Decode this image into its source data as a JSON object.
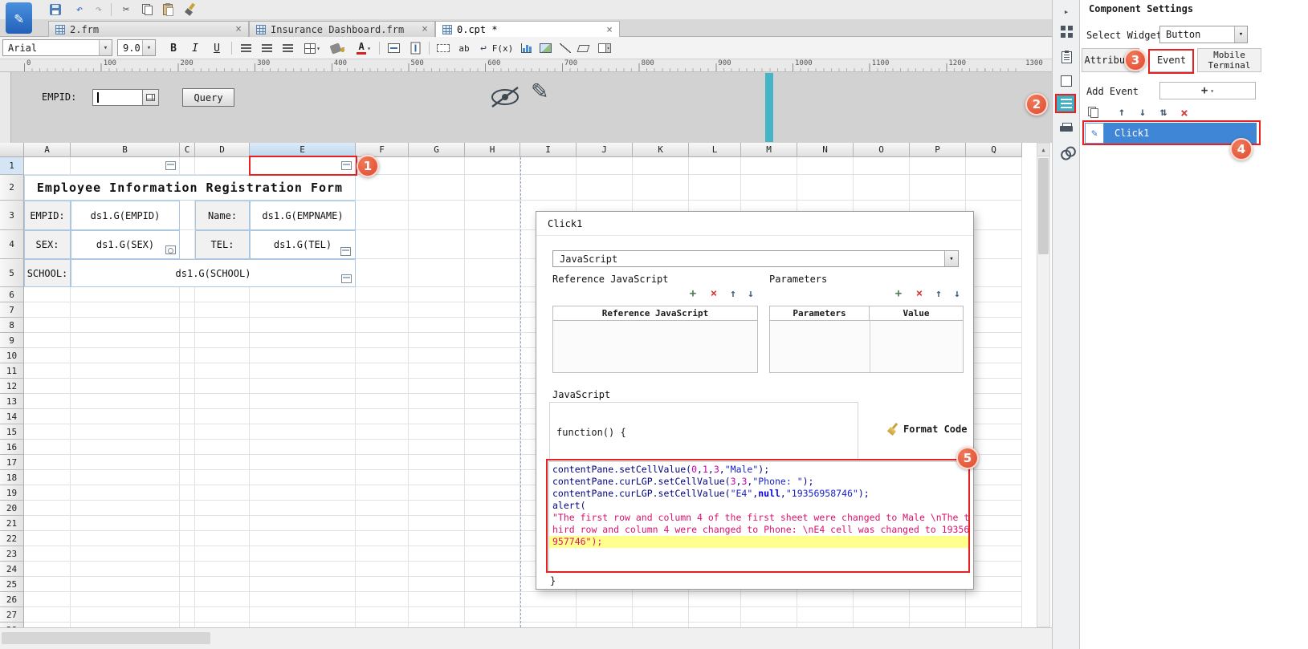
{
  "glyphs": {
    "close": "×",
    "dropdown": "▾",
    "up": "↑",
    "down": "↓",
    "sort": "⇅",
    "plus": "+",
    "delete": "×",
    "scroll_up": "▲",
    "chevron": "▸",
    "undo": "↶",
    "redo": "↷",
    "scissors": "✂",
    "pencil": "✎",
    "wrap": "↩"
  },
  "app": {
    "tabs": [
      {
        "label": "2.frm"
      },
      {
        "label": "Insurance Dashboard.frm"
      },
      {
        "label": "0.cpt *"
      }
    ]
  },
  "format_toolbar": {
    "font_name": "Arial",
    "font_size": "9.0",
    "bold": "B",
    "italic": "I",
    "underline": "U",
    "font_color": "A",
    "fx": "F(x)",
    "ab": "ab"
  },
  "ruler": {
    "ticks": [
      "0",
      "100",
      "200",
      "300",
      "400",
      "500",
      "600",
      "700",
      "800",
      "900",
      "1000",
      "1100",
      "1200",
      "1300"
    ]
  },
  "param_pane": {
    "empid_label": "EMPID:",
    "query_button": "Query"
  },
  "grid": {
    "columns": [
      "A",
      "B",
      "C",
      "D",
      "E",
      "F",
      "G",
      "H",
      "I",
      "J",
      "K",
      "L",
      "M",
      "N",
      "O",
      "P",
      "Q"
    ],
    "row_count": 28,
    "selected_column": "E",
    "selected_row": "1"
  },
  "report": {
    "title": "Employee Information Registration Form",
    "rows": [
      {
        "label1": "EMPID:",
        "value1": "ds1.G(EMPID)",
        "label2": "Name:",
        "value2": "ds1.G(EMPNAME)"
      },
      {
        "label1": "SEX:",
        "value1": "ds1.G(SEX)",
        "label2": "TEL:",
        "value2": "ds1.G(TEL)"
      },
      {
        "label1": "SCHOOL:",
        "value1": "ds1.G(SCHOOL)"
      }
    ]
  },
  "dialog": {
    "title": "Click1",
    "language": "JavaScript",
    "reference_label": "Reference JavaScript",
    "parameters_label": "Parameters",
    "reference_table_header": "Reference JavaScript",
    "parameters_table_headers": [
      "Parameters",
      "Value"
    ],
    "javascript_label": "JavaScript",
    "function_opening": "function() {",
    "format_code_label": "Format Code",
    "closing_brace": "}",
    "code_lines": [
      {
        "segments": [
          {
            "t": "contentPane.setCellValue(",
            "c": "p"
          },
          {
            "t": "0",
            "c": "n"
          },
          {
            "t": ",",
            "c": "p"
          },
          {
            "t": "1",
            "c": "n"
          },
          {
            "t": ",",
            "c": "p"
          },
          {
            "t": "3",
            "c": "n"
          },
          {
            "t": ",",
            "c": "p"
          },
          {
            "t": "\"Male\"",
            "c": "s"
          },
          {
            "t": ");",
            "c": "p"
          }
        ]
      },
      {
        "segments": [
          {
            "t": "contentPane.curLGP.setCellValue(",
            "c": "p"
          },
          {
            "t": "3",
            "c": "n"
          },
          {
            "t": ",",
            "c": "p"
          },
          {
            "t": "3",
            "c": "n"
          },
          {
            "t": ",",
            "c": "p"
          },
          {
            "t": "\"Phone: \"",
            "c": "s"
          },
          {
            "t": ");",
            "c": "p"
          }
        ]
      },
      {
        "segments": [
          {
            "t": "contentPane.curLGP.setCellValue(",
            "c": "p"
          },
          {
            "t": "\"E4\"",
            "c": "s"
          },
          {
            "t": ",",
            "c": "p"
          },
          {
            "t": "null",
            "c": "k"
          },
          {
            "t": ",",
            "c": "p"
          },
          {
            "t": "\"19356958746\"",
            "c": "s"
          },
          {
            "t": ");",
            "c": "p"
          }
        ]
      },
      {
        "segments": [
          {
            "t": "alert(",
            "c": "p"
          }
        ]
      },
      {
        "segments": [
          {
            "t": "\"The first row and column 4 of the first sheet were changed to Male \\nThe t",
            "c": "s2"
          }
        ]
      },
      {
        "segments": [
          {
            "t": "hird row and column 4 were changed to Phone: \\nE4 cell was changed to 19356",
            "c": "s2"
          }
        ]
      },
      {
        "highlight": true,
        "segments": [
          {
            "t": "957746\");",
            "c": "s2"
          }
        ]
      }
    ]
  },
  "right_panel": {
    "title": "Component Settings",
    "select_widget_label": "Select Widget",
    "selected_widget": "Button",
    "tabs": [
      {
        "label": "Attribute"
      },
      {
        "label": "Event"
      },
      {
        "label": "Mobile Terminal"
      }
    ],
    "add_event_label": "Add Event",
    "events": [
      {
        "label": "Click1"
      }
    ]
  },
  "annotations": {
    "markers": [
      "1",
      "2",
      "3",
      "4",
      "5"
    ]
  },
  "colors": {
    "annotation_red": "#ea1f1f",
    "marker_orange": "#e04a2f",
    "selection_blue": "#3f87d6",
    "teal_accent": "#3fb0c4"
  }
}
